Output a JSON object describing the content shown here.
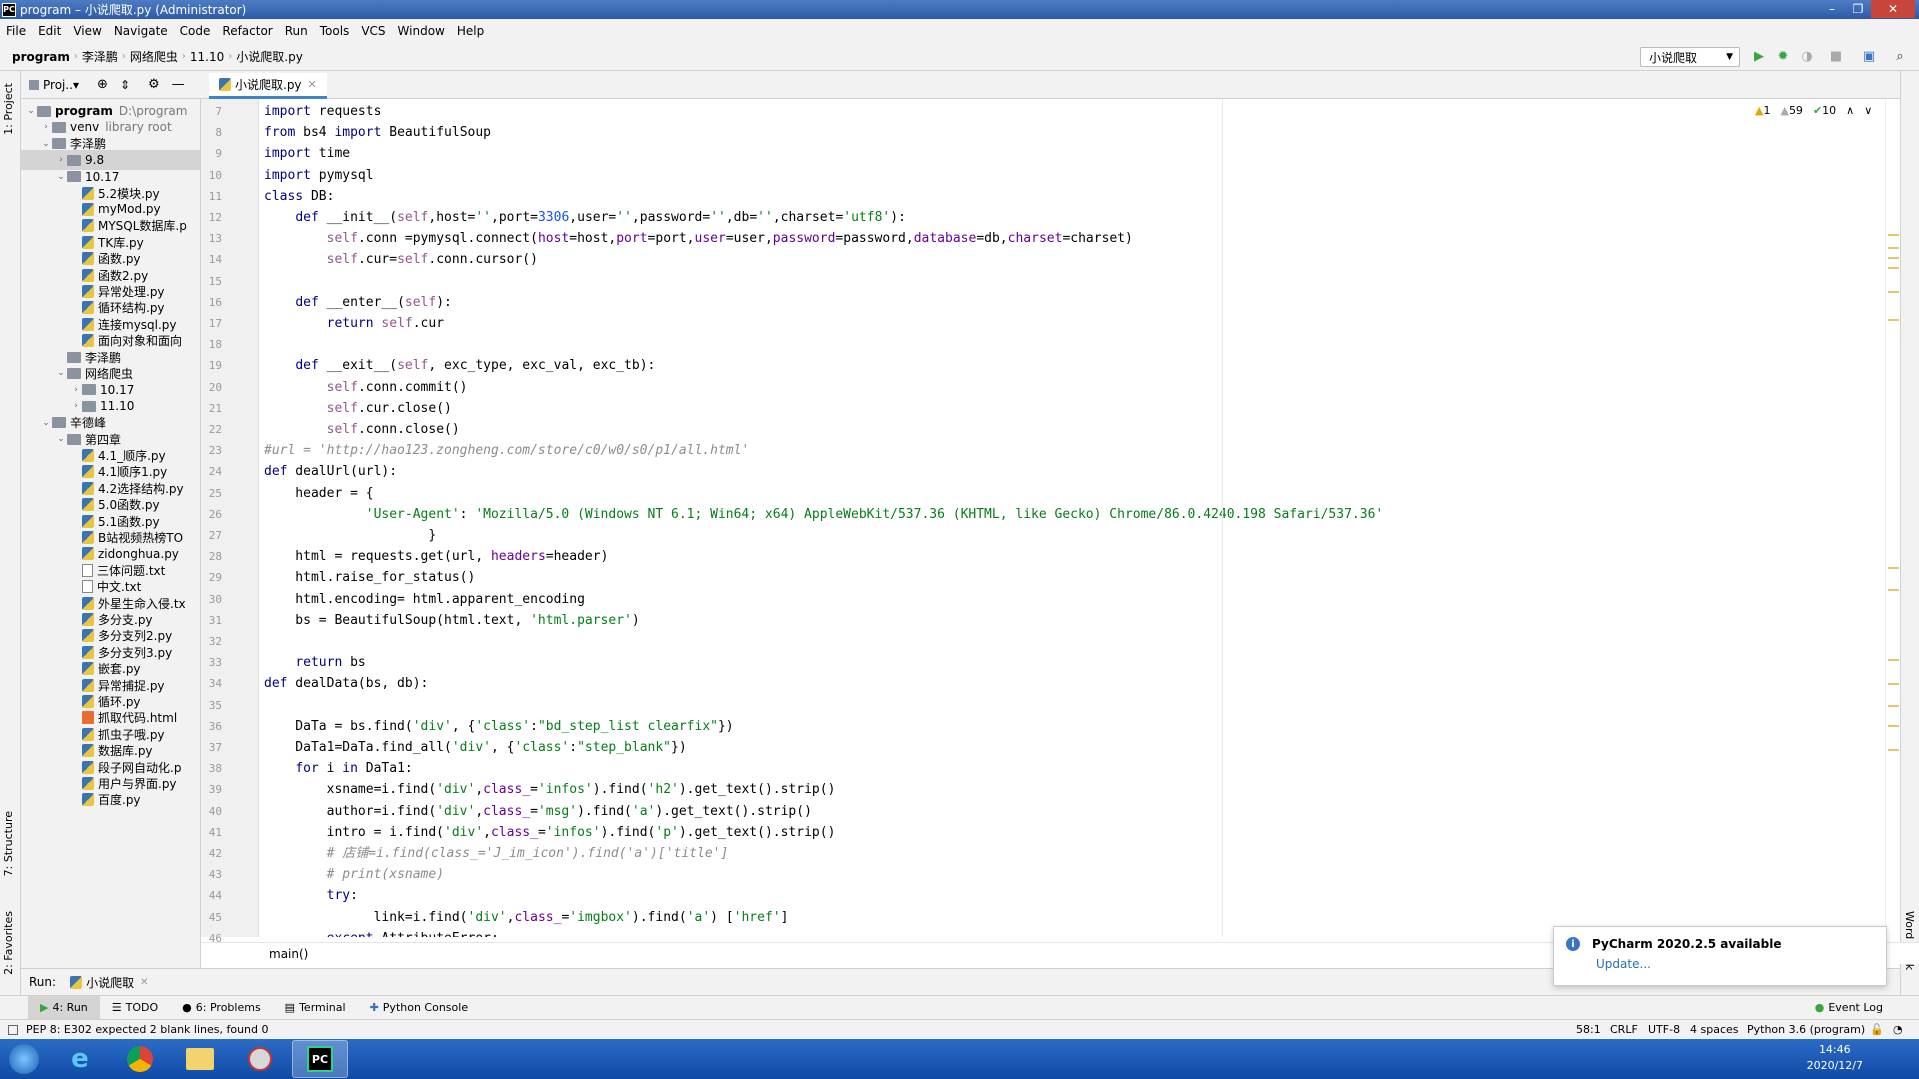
{
  "window": {
    "title": "program – 小说爬取.py (Administrator)"
  },
  "menu": [
    "File",
    "Edit",
    "View",
    "Navigate",
    "Code",
    "Refactor",
    "Run",
    "Tools",
    "VCS",
    "Window",
    "Help"
  ],
  "breadcrumb": [
    "program",
    "李泽鹏",
    "网络爬虫",
    "11.10",
    "小说爬取.py"
  ],
  "run_config": "小说爬取",
  "project": {
    "header": "Proj..▾",
    "tree": [
      {
        "d": 0,
        "a": "v",
        "t": "folder",
        "n": "program",
        "x": "D:\\program",
        "bold": true
      },
      {
        "d": 1,
        "a": ">",
        "t": "folder",
        "n": "venv",
        "x": "library root"
      },
      {
        "d": 1,
        "a": "v",
        "t": "folder",
        "n": "李泽鹏"
      },
      {
        "d": 2,
        "a": ">",
        "t": "folder",
        "n": "9.8",
        "sel": true
      },
      {
        "d": 2,
        "a": "v",
        "t": "folder",
        "n": "10.17"
      },
      {
        "d": 3,
        "t": "py",
        "n": "5.2模块.py"
      },
      {
        "d": 3,
        "t": "py",
        "n": "myMod.py"
      },
      {
        "d": 3,
        "t": "py",
        "n": "MYSQL数据库.p"
      },
      {
        "d": 3,
        "t": "py",
        "n": "TK库.py"
      },
      {
        "d": 3,
        "t": "py",
        "n": "函数.py"
      },
      {
        "d": 3,
        "t": "py",
        "n": "函数2.py"
      },
      {
        "d": 3,
        "t": "py",
        "n": "异常处理.py"
      },
      {
        "d": 3,
        "t": "py",
        "n": "循环结构.py"
      },
      {
        "d": 3,
        "t": "py",
        "n": "连接mysql.py"
      },
      {
        "d": 3,
        "t": "py",
        "n": "面向对象和面向"
      },
      {
        "d": 2,
        "t": "folder",
        "n": "李泽鹏"
      },
      {
        "d": 2,
        "a": "v",
        "t": "folder",
        "n": "网络爬虫"
      },
      {
        "d": 3,
        "a": ">",
        "t": "folder",
        "n": "10.17"
      },
      {
        "d": 3,
        "a": ">",
        "t": "folder",
        "n": "11.10"
      },
      {
        "d": 1,
        "a": "v",
        "t": "folder",
        "n": "辛德峰"
      },
      {
        "d": 2,
        "a": "v",
        "t": "folder",
        "n": "第四章"
      },
      {
        "d": 3,
        "t": "py",
        "n": "4.1_顺序.py"
      },
      {
        "d": 3,
        "t": "py",
        "n": "4.1顺序1.py"
      },
      {
        "d": 3,
        "t": "py",
        "n": "4.2选择结构.py"
      },
      {
        "d": 3,
        "t": "py",
        "n": "5.0函数.py"
      },
      {
        "d": 3,
        "t": "py",
        "n": "5.1函数.py"
      },
      {
        "d": 3,
        "t": "py",
        "n": "B站视频热榜TO"
      },
      {
        "d": 3,
        "t": "py",
        "n": "zidonghua.py"
      },
      {
        "d": 3,
        "t": "txt",
        "n": "三体问题.txt"
      },
      {
        "d": 3,
        "t": "txt",
        "n": "中文.txt"
      },
      {
        "d": 3,
        "t": "py",
        "n": "外星生命入侵.tx"
      },
      {
        "d": 3,
        "t": "py",
        "n": "多分支.py"
      },
      {
        "d": 3,
        "t": "py",
        "n": "多分支列2.py"
      },
      {
        "d": 3,
        "t": "py",
        "n": "多分支列3.py"
      },
      {
        "d": 3,
        "t": "py",
        "n": "嵌套.py"
      },
      {
        "d": 3,
        "t": "py",
        "n": "异常捕捉.py"
      },
      {
        "d": 3,
        "t": "py",
        "n": "循环.py"
      },
      {
        "d": 3,
        "t": "html",
        "n": "抓取代码.html"
      },
      {
        "d": 3,
        "t": "py",
        "n": "抓虫子哦.py"
      },
      {
        "d": 3,
        "t": "py",
        "n": "数据库.py"
      },
      {
        "d": 3,
        "t": "py",
        "n": "段子网自动化.p"
      },
      {
        "d": 3,
        "t": "py",
        "n": "用户与界面.py"
      },
      {
        "d": 3,
        "t": "py",
        "n": "百度.py"
      }
    ]
  },
  "editor": {
    "tab": "小说爬取.py",
    "inspections": {
      "warnings": "1",
      "weak": "59",
      "ok": "10"
    },
    "lines": [
      {
        "n": "7",
        "h": "<span class='kw'>import</span> requests"
      },
      {
        "n": "8",
        "h": "<span class='kw'>from</span> bs4 <span class='kw'>import</span> BeautifulSoup"
      },
      {
        "n": "9",
        "h": "<span class='kw'>import</span> time"
      },
      {
        "n": "10",
        "h": "<span class='kw'>import</span> pymysql"
      },
      {
        "n": "11",
        "h": "<span class='kw'>class</span> DB:"
      },
      {
        "n": "12",
        "h": "    <span class='kw'>def</span> __init__(<span class='self'>self</span>,host=<span class='st'>''</span>,port=<span class='num'>3306</span>,user=<span class='st'>''</span>,password=<span class='st'>''</span>,db=<span class='st'>''</span>,charset=<span class='st'>'utf8'</span>):"
      },
      {
        "n": "13",
        "h": "        <span class='self'>self</span>.conn =pymysql.connect(<span class='par'>host</span>=host,<span class='par'>port</span>=port,<span class='par'>user</span>=user,<span class='par'>password</span>=password,<span class='par'>database</span>=db,<span class='par'>charset</span>=charset)"
      },
      {
        "n": "14",
        "h": "        <span class='self'>self</span>.cur=<span class='self'>self</span>.conn.cursor()"
      },
      {
        "n": "15",
        "h": ""
      },
      {
        "n": "16",
        "h": "    <span class='kw'>def</span> __enter__(<span class='self'>self</span>):"
      },
      {
        "n": "17",
        "h": "        <span class='kw'>return</span> <span class='self'>self</span>.cur"
      },
      {
        "n": "18",
        "h": ""
      },
      {
        "n": "19",
        "h": "    <span class='kw'>def</span> __exit__(<span class='self'>self</span>, exc_type, exc_val, exc_tb):"
      },
      {
        "n": "20",
        "h": "        <span class='self'>self</span>.conn.commit()"
      },
      {
        "n": "21",
        "h": "        <span class='self'>self</span>.cur.close()"
      },
      {
        "n": "22",
        "h": "        <span class='self'>self</span>.conn.close()"
      },
      {
        "n": "23",
        "h": "<span class='cm'>#url = 'http://hao123.zongheng.com/store/c0/w0/s0/p1/all.html'</span>"
      },
      {
        "n": "24",
        "h": "<span class='kw'>def</span> dealUrl(url):"
      },
      {
        "n": "25",
        "h": "    header = {"
      },
      {
        "n": "26",
        "h": "             <span class='st'>'User-Agent'</span>: <span class='st'>'Mozilla/5.0 (Windows NT 6.1; Win64; x64) AppleWebKit/537.36 (KHTML, like Gecko) Chrome/86.0.4240.198 Safari/537.36'</span>"
      },
      {
        "n": "27",
        "h": "                     }"
      },
      {
        "n": "28",
        "h": "    html = requests.get(url, <span class='par'>headers</span>=header)"
      },
      {
        "n": "29",
        "h": "    html.raise_for_status()"
      },
      {
        "n": "30",
        "h": "    html.encoding= html.apparent_encoding"
      },
      {
        "n": "31",
        "h": "    bs = BeautifulSoup(html.text, <span class='st'>'html.parser'</span>)"
      },
      {
        "n": "32",
        "h": ""
      },
      {
        "n": "33",
        "h": "    <span class='kw'>return</span> bs"
      },
      {
        "n": "34",
        "h": "<span class='kw'>def</span> dealData(bs, db):"
      },
      {
        "n": "35",
        "h": ""
      },
      {
        "n": "36",
        "h": "    DaTa = bs.find(<span class='st'>'div'</span>, {<span class='st'>'class'</span>:<span class='st'>\"bd_step_list clearfix\"</span>})"
      },
      {
        "n": "37",
        "h": "    DaTa1=DaTa.find_all(<span class='st'>'div'</span>, {<span class='st'>'class'</span>:<span class='st'>\"step_blank\"</span>})"
      },
      {
        "n": "38",
        "h": "    <span class='kw'>for</span> i <span class='kw'>in</span> DaTa1:"
      },
      {
        "n": "39",
        "h": "        xsname=i.find(<span class='st'>'div'</span>,<span class='par'>class_</span>=<span class='st'>'infos'</span>).find(<span class='st'>'h2'</span>).get_text().strip()"
      },
      {
        "n": "40",
        "h": "        author=i.find(<span class='st'>'div'</span>,<span class='par'>class_</span>=<span class='st'>'msg'</span>).find(<span class='st'>'a'</span>).get_text().strip()"
      },
      {
        "n": "41",
        "h": "        intro = i.find(<span class='st'>'div'</span>,<span class='par'>class_</span>=<span class='st'>'infos'</span>).find(<span class='st'>'p'</span>).get_text().strip()"
      },
      {
        "n": "42",
        "h": "        <span class='cm'># 店铺=i.find(class_='J_im_icon').find('a')['title']</span>"
      },
      {
        "n": "43",
        "h": "        <span class='cm'># print(xsname)</span>"
      },
      {
        "n": "44",
        "h": "        <span class='kw'>try</span>:"
      },
      {
        "n": "45",
        "h": "              link=i.find(<span class='st'>'div'</span>,<span class='par'>class_</span>=<span class='st'>'imgbox'</span>).find(<span class='st'>'a'</span>) [<span class='st'>'href'</span>]"
      },
      {
        "n": "46",
        "h": "        <span class='kw'>except</span> AttributeError:"
      }
    ],
    "crumb": "main()"
  },
  "run": {
    "label": "Run:",
    "tab": "小说爬取"
  },
  "tooltabs": [
    "4: Run",
    "TODO",
    "6: Problems",
    "Terminal",
    "Python Console"
  ],
  "eventlog": "Event Log",
  "status": {
    "message": "PEP 8: E302 expected 2 blank lines, found 0",
    "pos": "58:1",
    "crlf": "CRLF",
    "enc": "UTF-8",
    "indent": "4 spaces",
    "interp": "Python 3.6 (program)"
  },
  "sidelabels": {
    "project": "1: Project",
    "structure": "7: Structure",
    "favorites": "2: Favorites",
    "wordbook": "Word Book"
  },
  "notification": {
    "title": "PyCharm 2020.2.5 available",
    "link": "Update..."
  },
  "clock": {
    "time": "14:46",
    "date": "2020/12/7"
  }
}
